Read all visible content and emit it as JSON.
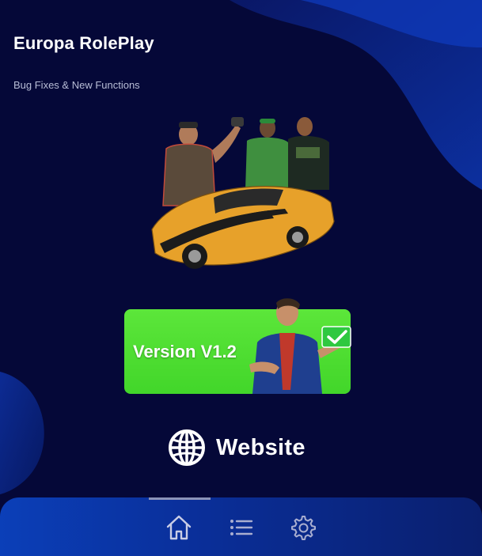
{
  "app": {
    "title": "Europa RolePlay",
    "subtitle": "Bug Fixes & New Functions"
  },
  "version_card": {
    "label": "Version V1.2",
    "color": "#4ddc30"
  },
  "website_button": {
    "label": "Website",
    "icon": "globe-icon"
  },
  "bottom_nav": {
    "items": [
      {
        "icon": "home-icon",
        "active": true
      },
      {
        "icon": "list-icon",
        "active": false
      },
      {
        "icon": "gear-icon",
        "active": false
      }
    ]
  },
  "colors": {
    "background": "#050838",
    "blob": "#0b2a8f",
    "nav_bar": "#0b3fb8",
    "text": "#ffffff",
    "subtitle": "#b8bdd6"
  }
}
